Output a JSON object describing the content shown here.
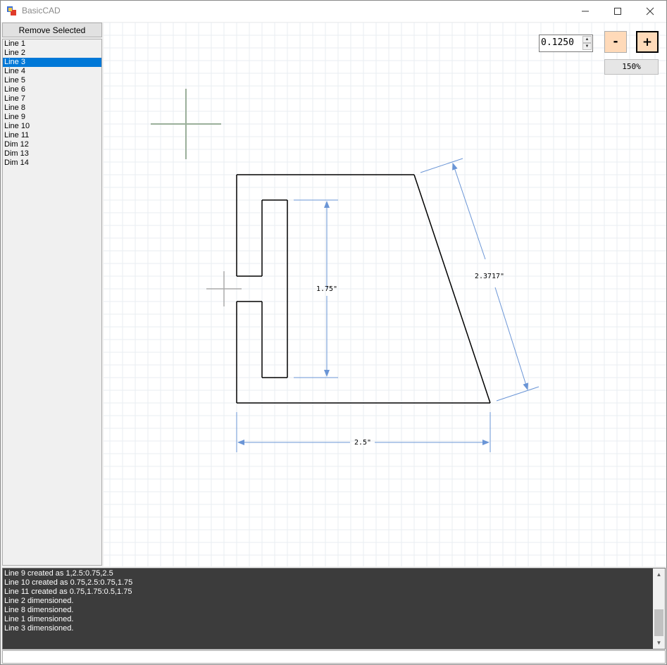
{
  "window": {
    "title": "BasicCAD",
    "icons": [
      "app-icon",
      "minimize-icon",
      "maximize-icon",
      "close-icon"
    ]
  },
  "sidebar": {
    "remove_button": "Remove Selected",
    "items": [
      {
        "label": "Line 1",
        "selected": false
      },
      {
        "label": "Line 2",
        "selected": false
      },
      {
        "label": "Line 3",
        "selected": true
      },
      {
        "label": "Line 4",
        "selected": false
      },
      {
        "label": "Line 5",
        "selected": false
      },
      {
        "label": "Line 6",
        "selected": false
      },
      {
        "label": "Line 7",
        "selected": false
      },
      {
        "label": "Line 8",
        "selected": false
      },
      {
        "label": "Line 9",
        "selected": false
      },
      {
        "label": "Line 10",
        "selected": false
      },
      {
        "label": "Line 11",
        "selected": false
      },
      {
        "label": "Dim 12",
        "selected": false
      },
      {
        "label": "Dim 13",
        "selected": false
      },
      {
        "label": "Dim 14",
        "selected": false
      }
    ]
  },
  "toolbar": {
    "snap_value": "0.1250",
    "zoom_out_label": "-",
    "zoom_in_label": "+",
    "zoom_level": "150%"
  },
  "drawing": {
    "dimension_labels": {
      "height": "1.75\"",
      "slant": "2.3717\"",
      "width": "2.5\""
    },
    "colors": {
      "line": "#000000",
      "dimension": "#6a95d6",
      "grid": "#e8eef2",
      "crosshair": "#9aaf9a",
      "selection": "#0078d7",
      "log_background": "#3c3c3c",
      "zoom_button": "#ffdab9"
    }
  },
  "log": {
    "lines": [
      "Line 9 created as 1,2.5:0.75,2.5",
      "Line 10 created as 0.75,2.5:0.75,1.75",
      "Line 11 created as 0.75,1.75:0.5,1.75",
      "Line 2 dimensioned.",
      "Line 8 dimensioned.",
      "Line 1 dimensioned.",
      "Line 3 dimensioned."
    ]
  },
  "command_input": {
    "value": ""
  }
}
